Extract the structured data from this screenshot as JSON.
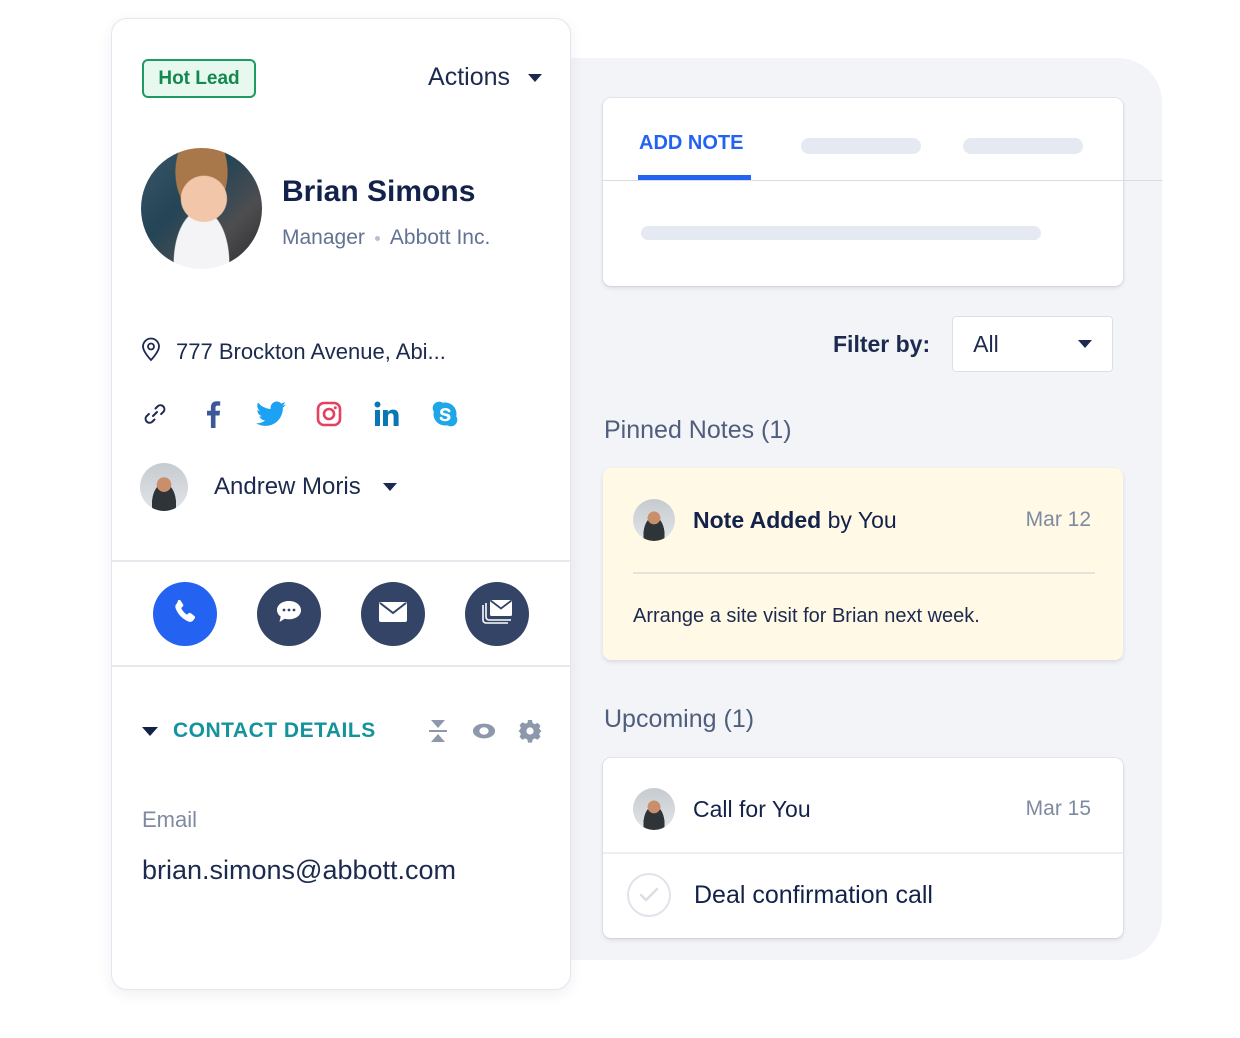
{
  "contact": {
    "badge": "Hot Lead",
    "actions_label": "Actions",
    "name": "Brian Simons",
    "title": "Manager",
    "company": "Abbott Inc.",
    "address": "777 Brockton Avenue, Abi...",
    "socials": [
      {
        "icon": "link-icon",
        "color": "#1b2a4e"
      },
      {
        "icon": "facebook-icon",
        "color": "#3b5998"
      },
      {
        "icon": "twitter-icon",
        "color": "#1da1f2"
      },
      {
        "icon": "instagram-icon",
        "color": "#e4405f"
      },
      {
        "icon": "linkedin-icon",
        "color": "#0a77b5"
      },
      {
        "icon": "skype-icon",
        "color": "#1ea7e8"
      }
    ],
    "owner": "Andrew Moris",
    "quick_actions": [
      {
        "icon": "phone-icon",
        "label": "Call"
      },
      {
        "icon": "chat-icon",
        "label": "Message"
      },
      {
        "icon": "email-icon",
        "label": "Email"
      },
      {
        "icon": "bulk-email-icon",
        "label": "Email sequence"
      }
    ],
    "section": {
      "title": "CONTACT DETAILS",
      "tools": [
        "collapse-icon",
        "eye-icon",
        "gear-icon"
      ]
    },
    "fields": {
      "email_label": "Email",
      "email_value": "brian.simons@abbott.com"
    }
  },
  "notes": {
    "tabs": [
      {
        "label": "ADD NOTE",
        "active": true
      }
    ],
    "filter_label": "Filter by:",
    "filter_value": "All",
    "pinned_title": "Pinned Notes (1)",
    "pinned": {
      "title_bold": "Note Added",
      "title_rest": " by You",
      "date": "Mar 12",
      "body": "Arrange a site visit for Brian next week."
    },
    "upcoming_title": "Upcoming (1)",
    "upcoming": {
      "title": "Call for You",
      "date": "Mar 15",
      "task": "Deal confirmation call"
    }
  },
  "colors": {
    "accent": "#2463f2",
    "hot_lead": "#1f9a63",
    "section_title": "#14939d",
    "pinned_bg": "#fff9e6"
  }
}
